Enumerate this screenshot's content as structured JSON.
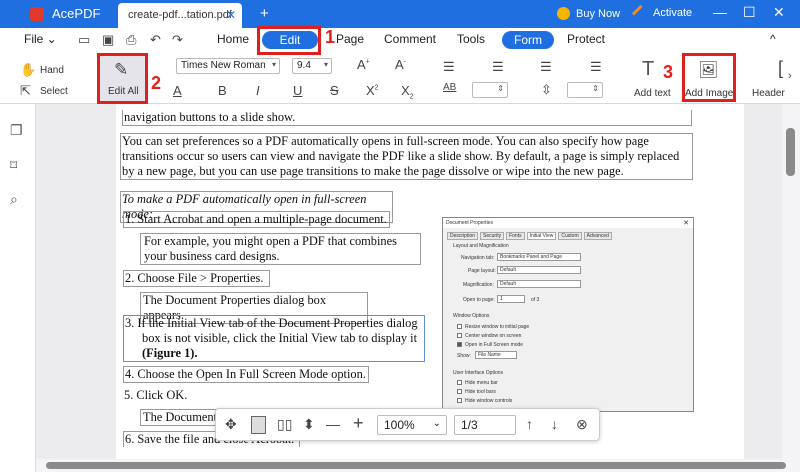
{
  "titlebar": {
    "app_name": "AcePDF",
    "tab_title": "create-pdf...tation.pdf",
    "tab_close": "✕",
    "new_tab": "+",
    "buy_now": "Buy Now",
    "activate": "Activate",
    "minimize": "—",
    "maximize": "☐",
    "close": "✕"
  },
  "menubar": {
    "file": "File ⌄",
    "items": [
      "Home",
      "Edit",
      "Page",
      "Comment",
      "Tools",
      "Form",
      "Protect"
    ],
    "collapse": "^"
  },
  "toolbar": {
    "hand": "Hand",
    "select": "Select",
    "edit_all": "Edit All",
    "font_family": "Times New Roman",
    "font_size": "9.4",
    "add_text": "Add text",
    "add_image": "Add Image",
    "header": "Header"
  },
  "annotations": {
    "one": "1",
    "two": "2",
    "three": "3"
  },
  "document": {
    "line_top": "navigation buttons to a slide show.",
    "para1": "You can set preferences so a PDF automatically opens in full-screen mode. You can also specify how page transitions occur so users can view and navigate the PDF like a slide show. By default, a page is simply replaced by a new page, but you can use page transitions to make the page dissolve or wipe into the new page.",
    "heading": "To make a PDF automatically open in full-screen mode:",
    "step1": "1.  Start Acrobat and open a multiple-page document.",
    "step1_note": "For example, you might open a PDF that combines your business card designs.",
    "step2": "2.  Choose File > Properties.",
    "step2_note": "The Document Properties dialog box appears.",
    "step3a": "3.  If the Initial View tab of the Document Properties dialog",
    "step3b": "box is not visible, click the Initial View tab to display it",
    "step3c": "(Figure 1).",
    "step4": "4.  Choose the Open In Full Screen Mode option.",
    "step5": "5.  Click OK.",
    "step5_note": "The Document",
    "step6": "6.  Save the file and close Acrobat."
  },
  "dialog": {
    "title": "Document Properties",
    "tabs": [
      "Description",
      "Security",
      "Fonts",
      "Initial View",
      "Custom",
      "Advanced"
    ],
    "section1": "Layout and Magnification",
    "nav_tab_label": "Navigation tab:",
    "nav_tab_value": "Bookmarks Panel and Page",
    "page_layout_label": "Page layout:",
    "page_layout_value": "Default",
    "magnification_label": "Magnification:",
    "magnification_value": "Default",
    "open_to_page_label": "Open to page:",
    "open_to_page_value": "1",
    "open_to_page_of": "of 3",
    "section2": "Window Options",
    "opt1": "Resize window to initial page",
    "opt2": "Center window on screen",
    "opt3": "Open in Full Screen mode",
    "show_label": "Show:",
    "show_value": "File Name",
    "section3": "User Interface Options",
    "opt4": "Hide menu bar",
    "opt5": "Hide tool bars",
    "opt6": "Hide window controls"
  },
  "floatbar": {
    "zoom": "100%",
    "page": "1/3"
  }
}
